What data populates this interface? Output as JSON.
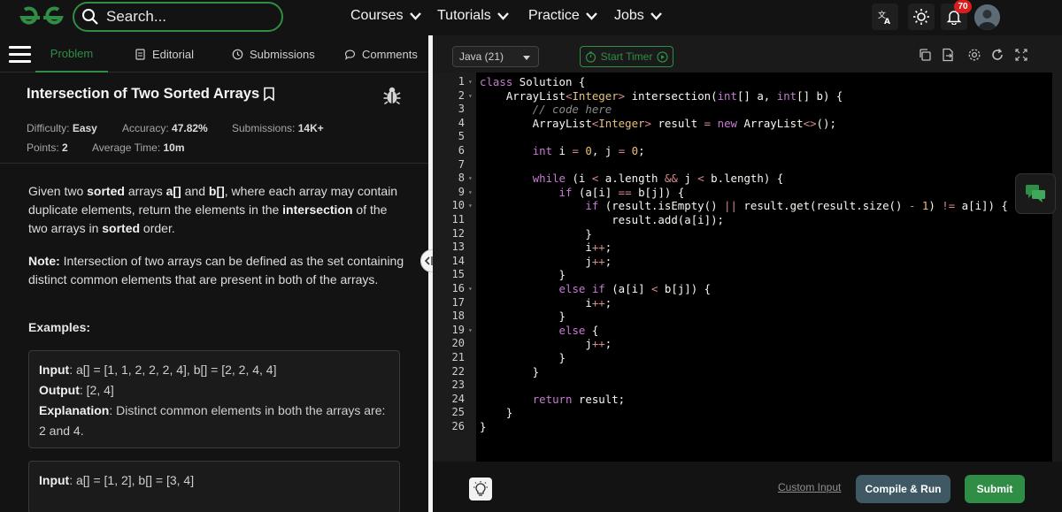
{
  "colors": {
    "brand": "#2f8d46",
    "badge": "#d91c1c",
    "compile": "#3e5864"
  },
  "search": {
    "placeholder": "Search..."
  },
  "nav": {
    "courses": "Courses",
    "tutorials": "Tutorials",
    "practice": "Practice",
    "jobs": "Jobs"
  },
  "notifications": {
    "count": "70"
  },
  "tabs": {
    "problem": "Problem",
    "editorial": "Editorial",
    "submissions": "Submissions",
    "comments": "Comments"
  },
  "problem": {
    "title": "Intersection of Two Sorted Arrays",
    "difficulty_label": "Difficulty:",
    "difficulty": "Easy",
    "accuracy_label": "Accuracy:",
    "accuracy": "47.82%",
    "submissions_label": "Submissions:",
    "submissions": "14K+",
    "points_label": "Points:",
    "points": "2",
    "avg_time_label": "Average Time:",
    "avg_time": "10m",
    "desc": [
      "Given two ",
      "sorted",
      " arrays ",
      "a[]",
      " and ",
      "b[]",
      ", where each array may contain duplicate elements, return the elements in the ",
      "intersection",
      " of the two arrays in ",
      "sorted",
      " order."
    ],
    "note_label": "Note:",
    "note": " Intersection of two arrays can be defined as the set containing distinct common elements that are present in both of the arrays.",
    "examples_label": "Examples:",
    "example1": {
      "input_label": "Input",
      "input": ": a[] = [1, 1, 2, 2, 2, 4], b[] = [2, 2, 4, 4]",
      "output_label": "Output",
      "output": ": [2, 4]",
      "explanation_label": "Explanation",
      "explanation": ": Distinct common elements in both the arrays are: 2 and 4."
    },
    "example2": {
      "input_label": "Input",
      "input": ": a[] = [1, 2], b[] = [3, 4]"
    }
  },
  "editor": {
    "language": "Java (21)",
    "start_timer": "Start Timer",
    "custom_input": "Custom Input",
    "compile_run": "Compile & Run",
    "submit": "Submit",
    "line_numbers": [
      "1",
      "2",
      "3",
      "4",
      "5",
      "6",
      "7",
      "8",
      "9",
      "10",
      "11",
      "12",
      "13",
      "14",
      "15",
      "16",
      "17",
      "18",
      "19",
      "20",
      "21",
      "22",
      "23",
      "24",
      "25",
      "26"
    ],
    "fold_lines": [
      1,
      2,
      8,
      9,
      10,
      16,
      19
    ],
    "code_lines": [
      "class Solution {",
      "    ArrayList<Integer> intersection(int[] a, int[] b) {",
      "        // code here",
      "        ArrayList<Integer> result = new ArrayList<>();",
      "",
      "        int i = 0, j = 0;",
      "",
      "        while (i < a.length && j < b.length) {",
      "            if (a[i] == b[j]) {",
      "                if (result.isEmpty() || result.get(result.size() - 1) != a[i]) {",
      "                    result.add(a[i]);",
      "                }",
      "                i++;",
      "                j++;",
      "            }",
      "            else if (a[i] < b[j]) {",
      "                i++;",
      "            }",
      "            else {",
      "                j++;",
      "            }",
      "        }",
      "",
      "        return result;",
      "    }",
      "}"
    ]
  }
}
